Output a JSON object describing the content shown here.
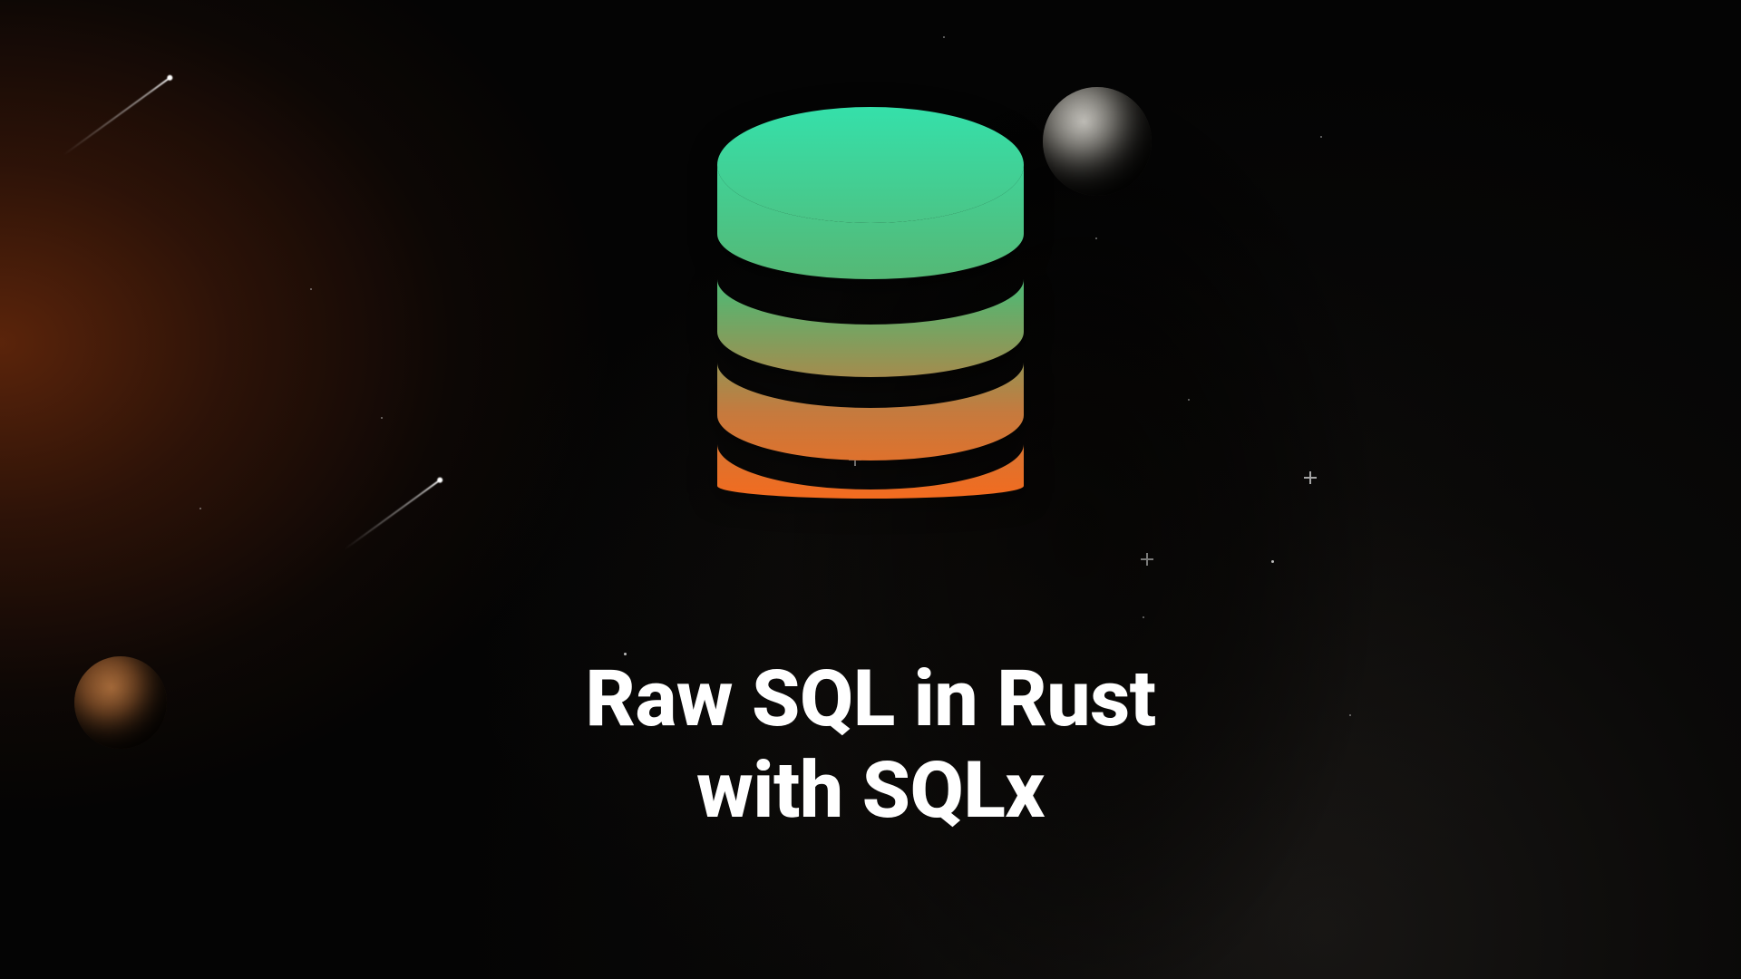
{
  "title_line1": "Raw SQL in Rust",
  "title_line2": "with SQLx",
  "icon": {
    "gradient_top": "#35e0aa",
    "gradient_mid": "#4fb77f",
    "gradient_bottom": "#f36b1f"
  },
  "planets": {
    "top_right": "grey",
    "bottom_left": "brown"
  }
}
